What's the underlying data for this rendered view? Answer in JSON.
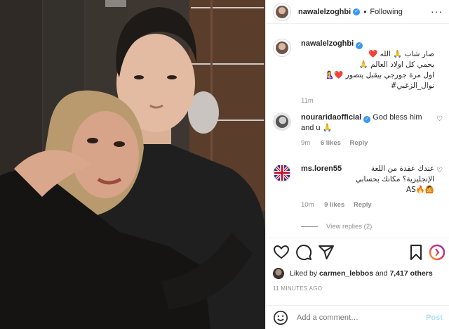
{
  "header": {
    "username": "nawalelzoghbi",
    "verified_icon": "✓",
    "separator": "•",
    "follow_label": "Following",
    "more_label": "···"
  },
  "caption": {
    "username": "nawalelzoghbi",
    "line1": "صار شاب 🙏 الله ❤️",
    "line2": "يحمي كل اولاد العالم 🙏",
    "line3": "اول مرة جورجي بيقبل يتصور ❤️🤱",
    "line4": "نوال_الزغبي#",
    "time": "11m"
  },
  "comments": [
    {
      "username": "nourarida",
      "username_suffix": "official",
      "text": "God bless him and u 🙏",
      "time": "9m",
      "likes": "6 likes",
      "reply": "Reply"
    },
    {
      "username": "ms.loren55",
      "text_line1": "عندك عقدة من اللغة",
      "text_line2": "الإنجليزية؟ مكانك بحسابي",
      "text_line3": "🙆🔥AS",
      "time": "10m",
      "likes": "9 likes",
      "reply": "Reply"
    }
  ],
  "view_replies": "View replies (2)",
  "likes": {
    "prefix": "Liked by",
    "user": "carmen_lebbos",
    "and": "and",
    "others": "7,417 others"
  },
  "timestamp": "11 MINUTES AGO",
  "add_comment": {
    "placeholder": "Add a comment…",
    "post_label": "Post"
  },
  "icons": {
    "like": "heart-icon",
    "comment": "comment-icon",
    "share": "share-icon",
    "save": "bookmark-icon",
    "emoji": "emoji-icon"
  },
  "colors": {
    "verified": "#3897f0",
    "muted": "#8e8e8e",
    "text": "#262626",
    "post_disabled": "#b2dffc",
    "border": "#efefef"
  }
}
